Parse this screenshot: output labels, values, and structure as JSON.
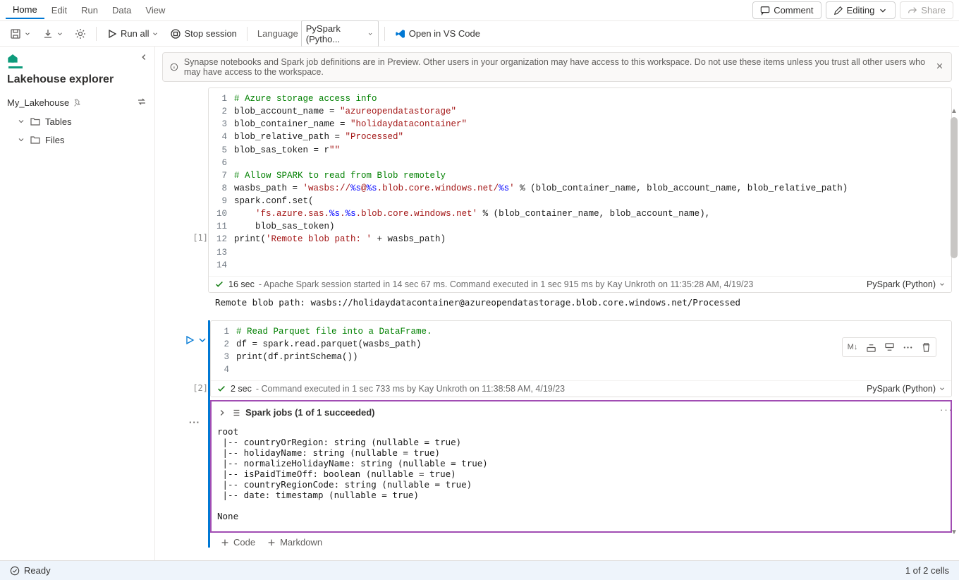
{
  "menubar": {
    "items": [
      "Home",
      "Edit",
      "Run",
      "Data",
      "View"
    ],
    "comment": "Comment",
    "editing": "Editing",
    "share": "Share"
  },
  "toolbar": {
    "run_all": "Run all",
    "stop_session": "Stop session",
    "language_label": "Language",
    "language_value": "PySpark (Pytho...",
    "open_vscode": "Open in VS Code"
  },
  "sidebar": {
    "title": "Lakehouse explorer",
    "lakehouse_name": "My_Lakehouse",
    "tree": {
      "tables": "Tables",
      "files": "Files"
    }
  },
  "banner": {
    "text": "Synapse notebooks and Spark job definitions are in Preview. Other users in your organization may have access to this workspace. Do not use these items unless you trust all other users who may have access to the workspace."
  },
  "cells": [
    {
      "index": "[1]",
      "code_lines": [
        [
          {
            "t": "cm",
            "v": "# Azure storage access info"
          }
        ],
        [
          {
            "t": "plain",
            "v": "blob_account_name = "
          },
          {
            "t": "str",
            "v": "\"azureopendatastorage\""
          }
        ],
        [
          {
            "t": "plain",
            "v": "blob_container_name = "
          },
          {
            "t": "str",
            "v": "\"holidaydatacontainer\""
          }
        ],
        [
          {
            "t": "plain",
            "v": "blob_relative_path = "
          },
          {
            "t": "str",
            "v": "\"Processed\""
          }
        ],
        [
          {
            "t": "plain",
            "v": "blob_sas_token = r"
          },
          {
            "t": "str",
            "v": "\"\""
          }
        ],
        [
          {
            "t": "plain",
            "v": ""
          }
        ],
        [
          {
            "t": "cm",
            "v": "# Allow SPARK to read from Blob remotely"
          }
        ],
        [
          {
            "t": "plain",
            "v": "wasbs_path = "
          },
          {
            "t": "str",
            "v": "'wasbs://"
          },
          {
            "t": "fmt",
            "v": "%s"
          },
          {
            "t": "str",
            "v": "@"
          },
          {
            "t": "fmt",
            "v": "%s"
          },
          {
            "t": "str",
            "v": ".blob.core.windows.net/"
          },
          {
            "t": "fmt",
            "v": "%s"
          },
          {
            "t": "str",
            "v": "'"
          },
          {
            "t": "plain",
            "v": " % (blob_container_name, blob_account_name, blob_relative_path)"
          }
        ],
        [
          {
            "t": "plain",
            "v": "spark.conf.set("
          }
        ],
        [
          {
            "t": "plain",
            "v": "    "
          },
          {
            "t": "str",
            "v": "'fs.azure.sas."
          },
          {
            "t": "fmt",
            "v": "%s"
          },
          {
            "t": "str",
            "v": "."
          },
          {
            "t": "fmt",
            "v": "%s"
          },
          {
            "t": "str",
            "v": ".blob.core.windows.net'"
          },
          {
            "t": "plain",
            "v": " % (blob_container_name, blob_account_name),"
          }
        ],
        [
          {
            "t": "plain",
            "v": "    blob_sas_token)"
          }
        ],
        [
          {
            "t": "plain",
            "v": "print("
          },
          {
            "t": "str",
            "v": "'Remote blob path: '"
          },
          {
            "t": "plain",
            "v": " + wasbs_path)"
          }
        ],
        [
          {
            "t": "plain",
            "v": ""
          }
        ],
        [
          {
            "t": "plain",
            "v": ""
          }
        ]
      ],
      "status_duration": "16 sec",
      "status_text": "- Apache Spark session started in 14 sec 67 ms. Command executed in 1 sec 915 ms by Kay Unkroth on 11:35:28 AM, 4/19/23",
      "lang": "PySpark (Python)",
      "output": "Remote blob path: wasbs://holidaydatacontainer@azureopendatastorage.blob.core.windows.net/Processed"
    },
    {
      "index": "[2]",
      "code_lines": [
        [
          {
            "t": "cm",
            "v": "# Read Parquet file into a DataFrame."
          }
        ],
        [
          {
            "t": "plain",
            "v": "df = spark.read.parquet(wasbs_path)"
          }
        ],
        [
          {
            "t": "plain",
            "v": "print(df.printSchema())"
          }
        ],
        [
          {
            "t": "plain",
            "v": ""
          }
        ]
      ],
      "status_duration": "2 sec",
      "status_text": "- Command executed in 1 sec 733 ms by Kay Unkroth on 11:38:58 AM, 4/19/23",
      "lang": "PySpark (Python)",
      "spark_jobs": "Spark jobs (1 of 1 succeeded)",
      "schema_output": "root\n |-- countryOrRegion: string (nullable = true)\n |-- holidayName: string (nullable = true)\n |-- normalizeHolidayName: string (nullable = true)\n |-- isPaidTimeOff: boolean (nullable = true)\n |-- countryRegionCode: string (nullable = true)\n |-- date: timestamp (nullable = true)\n\nNone"
    }
  ],
  "add_cell": {
    "code": "Code",
    "markdown": "Markdown"
  },
  "statusbar": {
    "ready": "Ready",
    "cells": "1 of 2 cells"
  }
}
